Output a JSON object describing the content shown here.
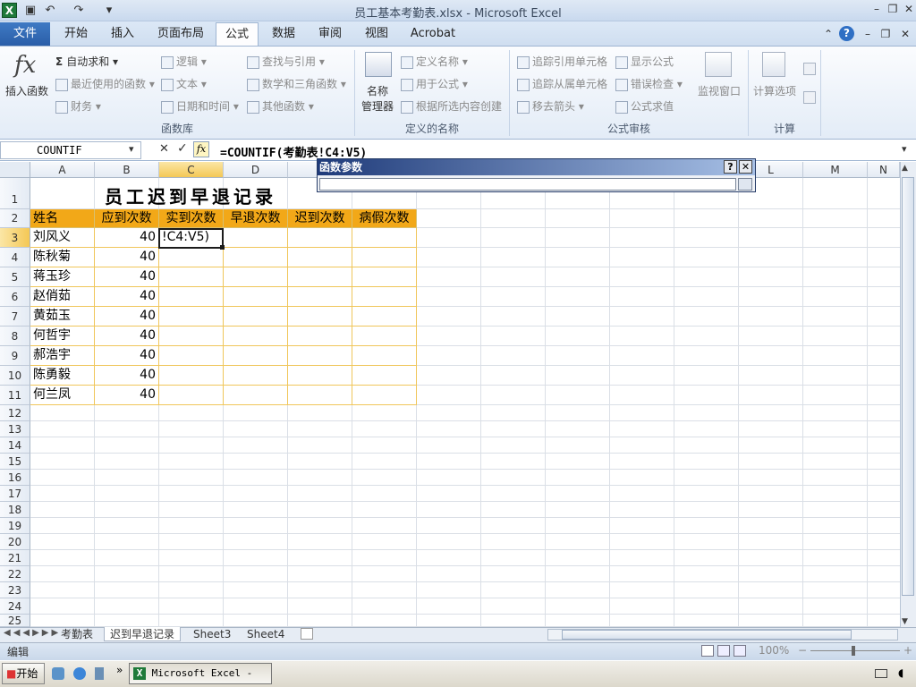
{
  "window": {
    "title": "员工基本考勤表.xlsx - Microsoft Excel",
    "app_icon": "X"
  },
  "tabs": {
    "file": "文件",
    "items": [
      "开始",
      "插入",
      "页面布局",
      "公式",
      "数据",
      "审阅",
      "视图",
      "Acrobat"
    ],
    "active": "公式"
  },
  "ribbon": {
    "insert_function": {
      "icon": "fx",
      "label": "插入函数"
    },
    "autosum": "自动求和",
    "recent": "最近使用的函数",
    "financial": "财务",
    "logical": "逻辑",
    "text": "文本",
    "datetime": "日期和时间",
    "lookup": "查找与引用",
    "math": "数学和三角函数",
    "other": "其他函数",
    "group_library": "函数库",
    "name_manager_1": "名称",
    "name_manager_2": "管理器",
    "define_name": "定义名称",
    "use_in_formula": "用于公式",
    "create_from_selection": "根据所选内容创建",
    "group_names": "定义的名称",
    "trace_precedents": "追踪引用单元格",
    "trace_dependents": "追踪从属单元格",
    "remove_arrows": "移去箭头",
    "show_formulas": "显示公式",
    "error_check": "错误检查",
    "evaluate": "公式求值",
    "watch": "监视窗口",
    "group_audit": "公式审核",
    "calc_options": "计算选项",
    "group_calc": "计算"
  },
  "formula_bar": {
    "name_box": "COUNTIF",
    "cancel": "✕",
    "enter": "✓",
    "fx": "fx",
    "formula": "=COUNTIF(考勤表!C4:V5)"
  },
  "dialog": {
    "title": "函数参数",
    "help": "?",
    "close": "✕"
  },
  "columns": [
    "A",
    "B",
    "C",
    "D",
    "",
    "",
    "",
    "",
    "",
    "",
    "",
    "L",
    "M",
    "N"
  ],
  "rows": [
    "1",
    "2",
    "3",
    "4",
    "5",
    "6",
    "7",
    "8",
    "9",
    "10",
    "11",
    "12",
    "13",
    "14",
    "15",
    "16",
    "17",
    "18",
    "19",
    "20",
    "21",
    "22",
    "23",
    "24",
    "25"
  ],
  "sheet": {
    "title": "员工迟到早退记录",
    "headers": [
      "姓名",
      "应到次数",
      "实到次数",
      "早退次数",
      "迟到次数",
      "病假次数"
    ],
    "data": [
      {
        "name": "刘风义",
        "expected": "40",
        "actual": "!C4:V5)"
      },
      {
        "name": "陈秋菊",
        "expected": "40",
        "actual": ""
      },
      {
        "name": "蒋玉珍",
        "expected": "40",
        "actual": ""
      },
      {
        "name": "赵俏茹",
        "expected": "40",
        "actual": ""
      },
      {
        "name": "黄茹玉",
        "expected": "40",
        "actual": ""
      },
      {
        "name": "何哲宇",
        "expected": "40",
        "actual": ""
      },
      {
        "name": "郝浩宇",
        "expected": "40",
        "actual": ""
      },
      {
        "name": "陈勇毅",
        "expected": "40",
        "actual": ""
      },
      {
        "name": "何兰凤",
        "expected": "40",
        "actual": ""
      }
    ]
  },
  "sheet_tabs": [
    "考勤表",
    "迟到早退记录",
    "Sheet3",
    "Sheet4"
  ],
  "active_sheet": "迟到早退记录",
  "status": {
    "mode": "编辑",
    "zoom": "100%"
  },
  "taskbar": {
    "start": "开始",
    "window": "Microsoft Excel - ..."
  }
}
